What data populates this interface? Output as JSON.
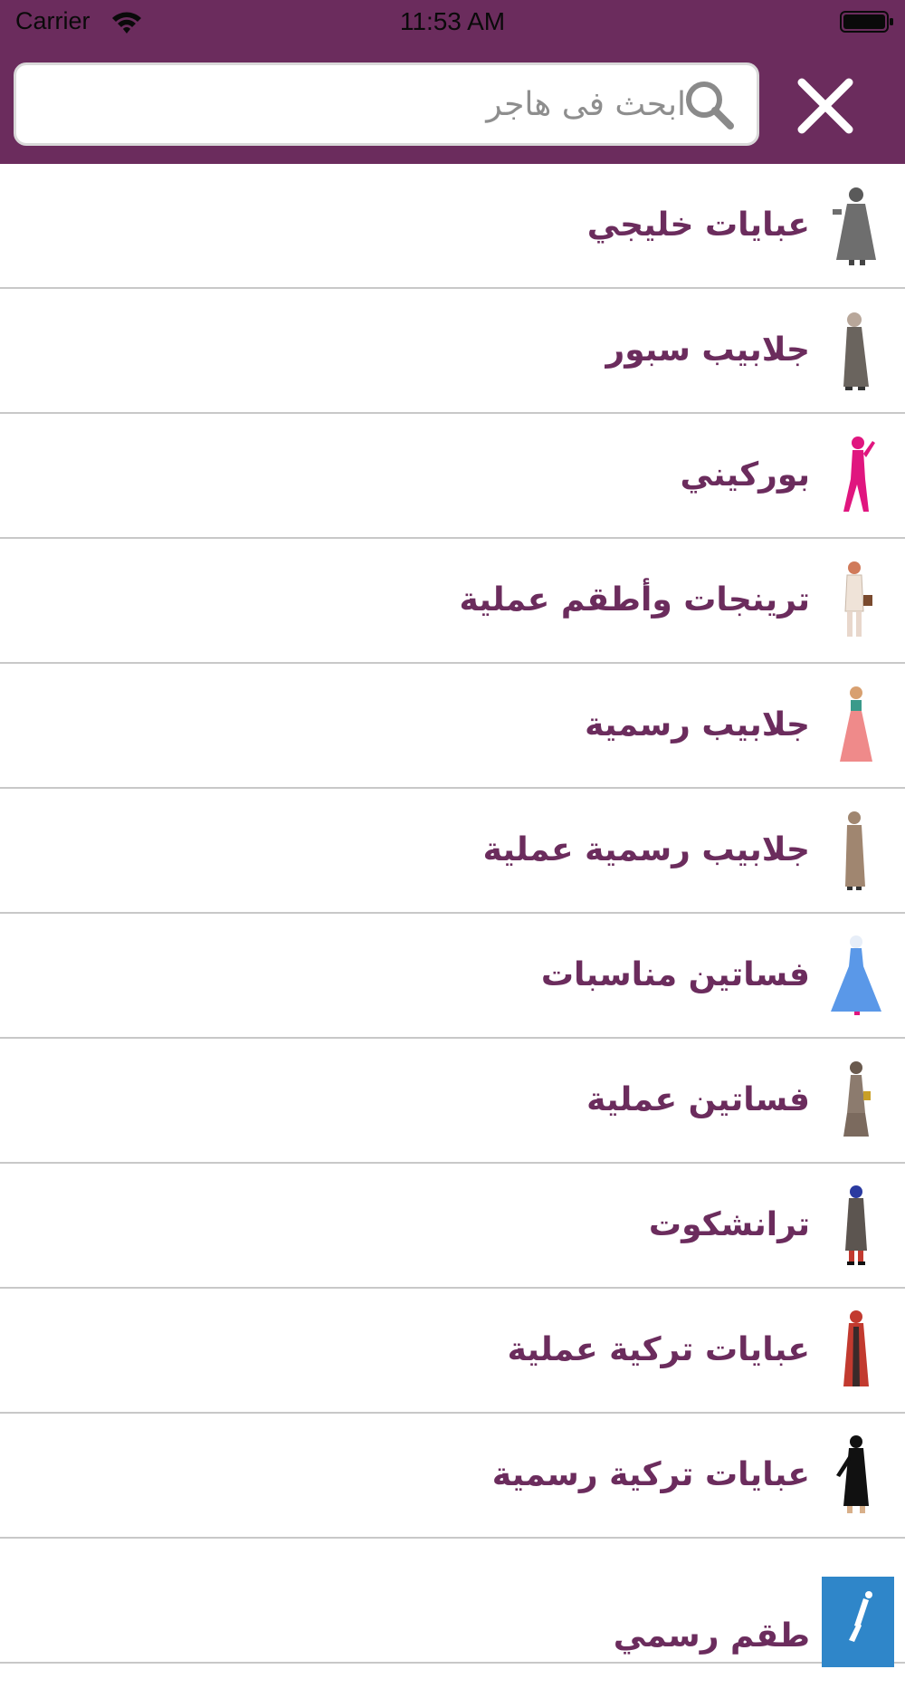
{
  "status_bar": {
    "carrier": "Carrier",
    "time": "11:53 AM"
  },
  "search": {
    "placeholder": "ابحث فى هاجر",
    "value": ""
  },
  "colors": {
    "header": "#6b2c5d",
    "label": "#6b2c5d"
  },
  "categories": [
    {
      "label": "عبايات خليجي",
      "icon": "gray-abaya-figure",
      "color": "#6e6e6e"
    },
    {
      "label": "جلابيب سبور",
      "icon": "gray-jilbab-figure",
      "color": "#6a645e"
    },
    {
      "label": "بوركيني",
      "icon": "pink-burkini-figure",
      "color": "#e0167f"
    },
    {
      "label": "ترينجات وأطقم عملية",
      "icon": "beige-outfit-figure",
      "color": "#efe3d8"
    },
    {
      "label": "جلابيب رسمية",
      "icon": "pink-dress-figure",
      "color": "#ef8a8a"
    },
    {
      "label": "جلابيب رسمية عملية",
      "icon": "brown-jilbab-figure",
      "color": "#a08670"
    },
    {
      "label": "فساتين مناسبات",
      "icon": "blue-gown-figure",
      "color": "#5a98e8"
    },
    {
      "label": "فساتين عملية",
      "icon": "taupe-dress-figure",
      "color": "#8c7b6e"
    },
    {
      "label": "ترانشكوت",
      "icon": "trenchcoat-figure",
      "color": "#5c5550"
    },
    {
      "label": "عبايات تركية عملية",
      "icon": "red-abaya-figure",
      "color": "#c23a2f"
    },
    {
      "label": "عبايات تركية رسمية",
      "icon": "black-abaya-figure",
      "color": "#111111"
    },
    {
      "label": "طقم رسمي",
      "icon": "blue-square-figure",
      "color": "#2f86c9"
    }
  ]
}
